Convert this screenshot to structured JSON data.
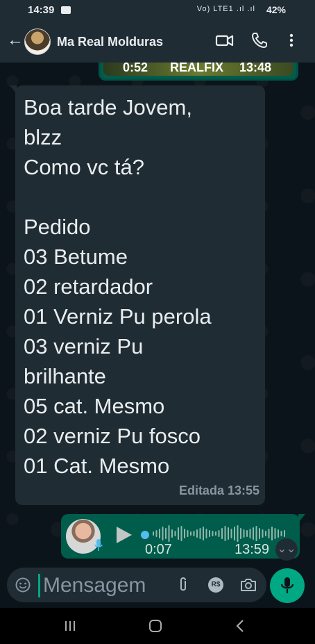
{
  "status_bar": {
    "time": "14:39",
    "network": "Vo) LTE1 .ıl .ıl",
    "battery": "42%"
  },
  "header": {
    "contact_name": "Ma Real Molduras"
  },
  "previous_media": {
    "left_text": "0:52",
    "center_text": "REALFIX",
    "right_text": "13:48"
  },
  "incoming_message": {
    "lines": [
      "Boa tarde Jovem,",
      "blzz",
      "Como vc tá?",
      "",
      "Pedido",
      "03 Betume",
      "02 retardador",
      "01 Verniz Pu perola",
      "03 verniz Pu",
      "brilhante",
      "05 cat. Mesmo",
      "02 verniz Pu fosco",
      "01 Cat. Mesmo"
    ],
    "edited_label": "Editada 13:55"
  },
  "voice_message": {
    "duration": "0:07",
    "time": "13:59",
    "progress": 0
  },
  "composer": {
    "placeholder": "Mensagem",
    "payment_label": "R$"
  },
  "colors": {
    "header_bg": "#1f2c34",
    "chat_bg": "#0b141a",
    "incoming_bubble": "#202c33",
    "outgoing_bubble": "#005c4b",
    "accent": "#00a884",
    "playhead": "#53bdeb"
  }
}
